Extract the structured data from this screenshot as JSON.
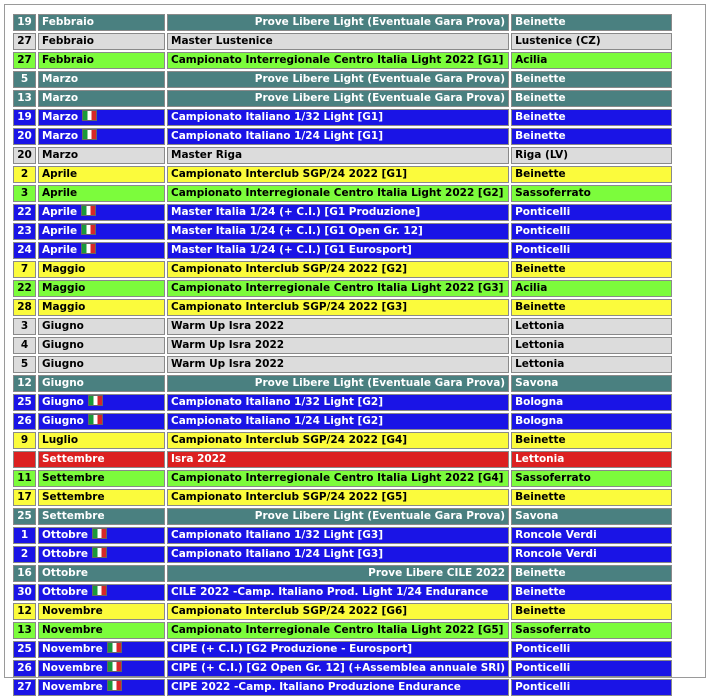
{
  "colors": {
    "teal": "#4a8080",
    "gray": "#dcdcdc",
    "green": "#7cfc3c",
    "blue": "#1a14e6",
    "yellow": "#fbfb3c",
    "red": "#dc2020"
  },
  "rows": [
    {
      "day": "19",
      "month": "Febbraio",
      "flag": false,
      "event": "Prove Libere Light (Eventuale Gara Prova)",
      "place": "Beinette",
      "style": "teal",
      "align": "right"
    },
    {
      "day": "27",
      "month": "Febbraio",
      "flag": false,
      "event": "Master Lustenice",
      "place": "Lustenice (CZ)",
      "style": "gray",
      "align": "left"
    },
    {
      "day": "27",
      "month": "Febbraio",
      "flag": false,
      "event": "Campionato Interregionale Centro Italia Light  2022 [G1]",
      "place": "Acilia",
      "style": "green",
      "align": "left"
    },
    {
      "day": "5",
      "month": "Marzo",
      "flag": false,
      "event": "Prove Libere Light (Eventuale Gara Prova)",
      "place": "Beinette",
      "style": "teal",
      "align": "right"
    },
    {
      "day": "13",
      "month": "Marzo",
      "flag": false,
      "event": "Prove Libere Light (Eventuale Gara Prova)",
      "place": "Beinette",
      "style": "teal",
      "align": "right"
    },
    {
      "day": "19",
      "month": "Marzo",
      "flag": true,
      "event": "Campionato Italiano 1/32 Light  [G1]",
      "place": "Beinette",
      "style": "blue",
      "align": "left"
    },
    {
      "day": "20",
      "month": "Marzo",
      "flag": true,
      "event": "Campionato Italiano 1/24 Light  [G1]",
      "place": "Beinette",
      "style": "blue",
      "align": "left"
    },
    {
      "day": "20",
      "month": "Marzo",
      "flag": false,
      "event": "Master Riga",
      "place": "Riga (LV)",
      "style": "gray",
      "align": "left"
    },
    {
      "day": "2",
      "month": "Aprile",
      "flag": false,
      "event": "Campionato Interclub SGP/24 2022 [G1]",
      "place": "Beinette",
      "style": "yellow",
      "align": "left"
    },
    {
      "day": "3",
      "month": "Aprile",
      "flag": false,
      "event": "Campionato Interregionale Centro Italia Light  2022 [G2]",
      "place": "Sassoferrato",
      "style": "green",
      "align": "left"
    },
    {
      "day": "22",
      "month": "Aprile",
      "flag": true,
      "event": "Master Italia 1/24  (+ C.I.) [G1 Produzione]",
      "place": "Ponticelli",
      "style": "blue",
      "align": "left"
    },
    {
      "day": "23",
      "month": "Aprile",
      "flag": true,
      "event": "Master Italia 1/24  (+ C.I.) [G1 Open Gr. 12]",
      "place": "Ponticelli",
      "style": "blue",
      "align": "left"
    },
    {
      "day": "24",
      "month": "Aprile",
      "flag": true,
      "event": "Master Italia 1/24  (+ C.I.) [G1 Eurosport]",
      "place": "Ponticelli",
      "style": "blue",
      "align": "left"
    },
    {
      "day": "7",
      "month": "Maggio",
      "flag": false,
      "event": "Campionato Interclub SGP/24 2022 [G2]",
      "place": "Beinette",
      "style": "yellow",
      "align": "left"
    },
    {
      "day": "22",
      "month": "Maggio",
      "flag": false,
      "event": "Campionato Interregionale Centro Italia Light  2022 [G3]",
      "place": "Acilia",
      "style": "green",
      "align": "left"
    },
    {
      "day": "28",
      "month": "Maggio",
      "flag": false,
      "event": "Campionato Interclub SGP/24 2022 [G3]",
      "place": "Beinette",
      "style": "yellow",
      "align": "left"
    },
    {
      "day": "3",
      "month": "Giugno",
      "flag": false,
      "event": "Warm Up Isra 2022",
      "place": "Lettonia",
      "style": "gray",
      "align": "left"
    },
    {
      "day": "4",
      "month": "Giugno",
      "flag": false,
      "event": "Warm Up Isra 2022",
      "place": "Lettonia",
      "style": "gray",
      "align": "left"
    },
    {
      "day": "5",
      "month": "Giugno",
      "flag": false,
      "event": "Warm Up Isra 2022",
      "place": "Lettonia",
      "style": "gray",
      "align": "left"
    },
    {
      "day": "12",
      "month": "Giugno",
      "flag": false,
      "event": "Prove Libere Light (Eventuale Gara Prova)",
      "place": "Savona",
      "style": "teal",
      "align": "right"
    },
    {
      "day": "25",
      "month": "Giugno",
      "flag": true,
      "event": "Campionato Italiano 1/32 Light  [G2]",
      "place": "Bologna",
      "style": "blue",
      "align": "left"
    },
    {
      "day": "26",
      "month": "Giugno",
      "flag": true,
      "event": "Campionato Italiano 1/24 Light  [G2]",
      "place": "Bologna",
      "style": "blue",
      "align": "left"
    },
    {
      "day": "9",
      "month": "Luglio",
      "flag": false,
      "event": "Campionato Interclub SGP/24 2022 [G4]",
      "place": "Beinette",
      "style": "yellow",
      "align": "left"
    },
    {
      "day": "",
      "month": "Settembre",
      "flag": false,
      "event": "Isra 2022",
      "place": "Lettonia",
      "style": "red",
      "align": "left"
    },
    {
      "day": "11",
      "month": "Settembre",
      "flag": false,
      "event": "Campionato Interregionale Centro Italia Light  2022 [G4]",
      "place": "Sassoferrato",
      "style": "green",
      "align": "left"
    },
    {
      "day": "17",
      "month": "Settembre",
      "flag": false,
      "event": "Campionato Interclub SGP/24 2022 [G5]",
      "place": "Beinette",
      "style": "yellow",
      "align": "left"
    },
    {
      "day": "25",
      "month": "Settembre",
      "flag": false,
      "event": "Prove Libere Light (Eventuale Gara Prova)",
      "place": "Savona",
      "style": "teal",
      "align": "right"
    },
    {
      "day": "1",
      "month": "Ottobre",
      "flag": true,
      "event": "Campionato Italiano 1/32 Light  [G3]",
      "place": "Roncole Verdi",
      "style": "blue",
      "align": "left"
    },
    {
      "day": "2",
      "month": "Ottobre",
      "flag": true,
      "event": "Campionato Italiano 1/24 Light  [G3]",
      "place": "Roncole Verdi",
      "style": "blue",
      "align": "left"
    },
    {
      "day": "16",
      "month": "Ottobre",
      "flag": false,
      "event": "Prove Libere CILE 2022",
      "place": "Beinette",
      "style": "teal",
      "align": "right"
    },
    {
      "day": "30",
      "month": "Ottobre",
      "flag": true,
      "event": "CILE 2022 -Camp. Italiano Prod. Light 1/24 Endurance",
      "place": "Beinette",
      "style": "blue",
      "align": "left"
    },
    {
      "day": "12",
      "month": "Novembre",
      "flag": false,
      "event": "Campionato Interclub SGP/24 2022 [G6]",
      "place": "Beinette",
      "style": "yellow",
      "align": "left"
    },
    {
      "day": "13",
      "month": "Novembre",
      "flag": false,
      "event": "Campionato Interregionale Centro Italia Light  2022 [G5]",
      "place": "Sassoferrato",
      "style": "green",
      "align": "left"
    },
    {
      "day": "25",
      "month": "Novembre",
      "flag": true,
      "event": "CIPE  (+ C.I.) [G2 Produzione - Eurosport]",
      "place": "Ponticelli",
      "style": "blue",
      "align": "left"
    },
    {
      "day": "26",
      "month": "Novembre",
      "flag": true,
      "event": "CIPE  (+ C.I.) [G2 Open Gr. 12] (+Assemblea annuale SRI)",
      "place": "Ponticelli",
      "style": "blue",
      "align": "left"
    },
    {
      "day": "27",
      "month": "Novembre",
      "flag": true,
      "event": "CIPE 2022 -Camp. Italiano Produzione Endurance",
      "place": "Ponticelli",
      "style": "blue",
      "align": "left"
    }
  ]
}
